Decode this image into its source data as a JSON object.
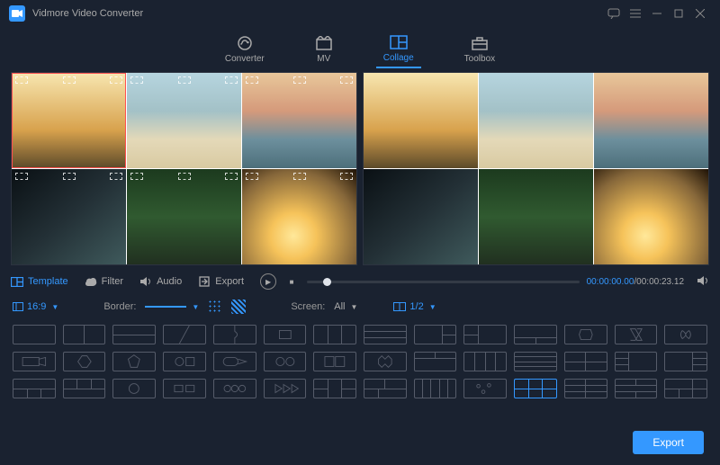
{
  "app": {
    "title": "Vidmore Video Converter"
  },
  "nav": {
    "items": [
      {
        "label": "Converter"
      },
      {
        "label": "MV"
      },
      {
        "label": "Collage"
      },
      {
        "label": "Toolbox"
      }
    ],
    "active": 2
  },
  "tabs": {
    "items": [
      {
        "label": "Template"
      },
      {
        "label": "Filter"
      },
      {
        "label": "Audio"
      },
      {
        "label": "Export"
      }
    ],
    "active": 0
  },
  "player": {
    "current": "00:00:00.00",
    "total": "00:00:23.12"
  },
  "toolbar": {
    "ratio": "16:9",
    "border_label": "Border:",
    "screen_label": "Screen:",
    "screen_value": "All",
    "split_value": "1/2"
  },
  "footer": {
    "export": "Export"
  }
}
